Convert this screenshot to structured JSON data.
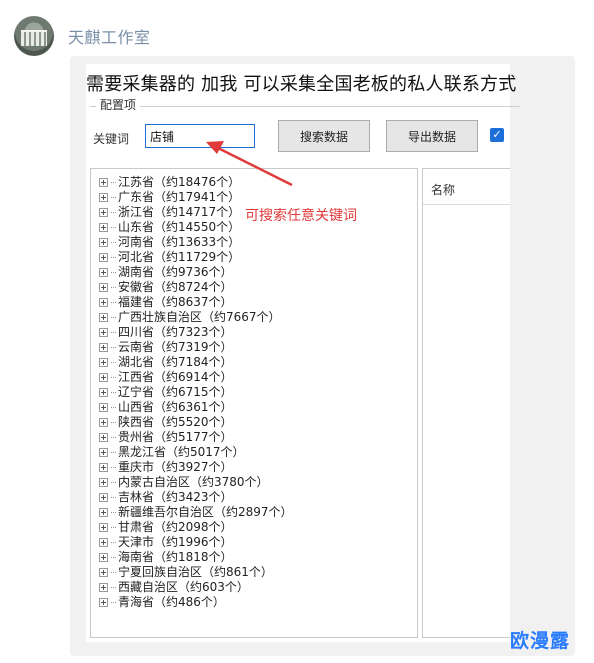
{
  "chat": {
    "sender_name": "天麒工作室"
  },
  "app": {
    "headline": "需要采集器的 加我 可以采集全国老板的私人联系方式",
    "group_label": "配置项",
    "keyword_label": "关键词",
    "keyword_value": "店铺",
    "search_button": "搜索数据",
    "export_button": "导出数据",
    "checkbox_checked": true,
    "list_header": "名称",
    "annotation": "可搜索任意关键词",
    "accent_color": "#1e6fd9",
    "annotation_color": "#e03a3a"
  },
  "provinces": [
    "江苏省（约18476个）",
    "广东省（约17941个）",
    "浙江省（约14717个）",
    "山东省（约14550个）",
    "河南省（约13633个）",
    "河北省（约11729个）",
    "湖南省（约9736个）",
    "安徽省（约8724个）",
    "福建省（约8637个）",
    "广西壮族自治区（约7667个）",
    "四川省（约7323个）",
    "云南省（约7319个）",
    "湖北省（约7184个）",
    "江西省（约6914个）",
    "辽宁省（约6715个）",
    "山西省（约6361个）",
    "陕西省（约5520个）",
    "贵州省（约5177个）",
    "黑龙江省（约5017个）",
    "重庆市（约3927个）",
    "内蒙古自治区（约3780个）",
    "吉林省（约3423个）",
    "新疆维吾尔自治区（约2897个）",
    "甘肃省（约2098个）",
    "天津市（约1996个）",
    "海南省（约1818个）",
    "宁夏回族自治区（约861个）",
    "西藏自治区（约603个）",
    "青海省（约486个）"
  ],
  "watermark": "欧漫露"
}
